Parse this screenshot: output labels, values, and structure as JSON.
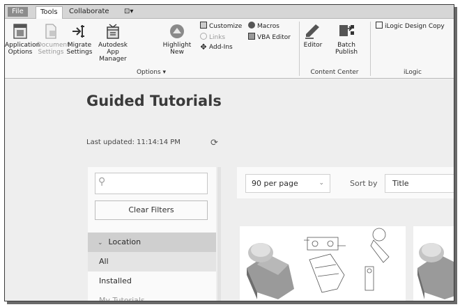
{
  "tabs": [
    "File",
    "Tools",
    "Collaborate",
    "⊡▾"
  ],
  "ribbon": {
    "app_options": [
      "Application",
      "Options"
    ],
    "doc_settings": [
      "Document",
      "Settings"
    ],
    "migrate": [
      "Migrate",
      "Settings"
    ],
    "app_manager": [
      "Autodesk",
      "App Manager"
    ],
    "highlight_new": [
      "Highlight",
      "New"
    ],
    "customize": "Customize",
    "links": "Links",
    "add_ins": "Add-Ins",
    "macros": "Macros",
    "vba_editor": "VBA Editor",
    "options_group": "Options ▾",
    "editor": "Editor",
    "batch_publish": "Batch Publish",
    "content_center_group": "Content Center",
    "ilogic_copy": "iLogic Design Copy",
    "ilogic_group": "iLogic"
  },
  "page": {
    "title": "Guided Tutorials",
    "last_updated": "Last updated: 11:14:14 PM"
  },
  "filters": {
    "clear_label": "Clear Filters",
    "location_label": "Location",
    "items": [
      "All",
      "Installed",
      "My Tutorials"
    ]
  },
  "toolbar": {
    "per_page": "90  per page",
    "sort_by_label": "Sort by",
    "sort_value": "Title"
  }
}
